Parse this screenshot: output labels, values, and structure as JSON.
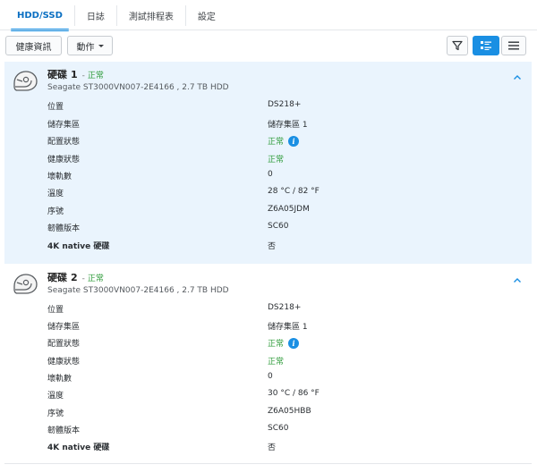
{
  "tabs": [
    {
      "label": "HDD/SSD",
      "active": true
    },
    {
      "label": "日誌",
      "active": false
    },
    {
      "label": "測試排程表",
      "active": false
    },
    {
      "label": "設定",
      "active": false
    }
  ],
  "toolbar": {
    "health_label": "健康資訊",
    "action_label": "動作",
    "filter_icon": "filter-icon",
    "detail_view_icon": "detail-list-icon",
    "list_view_icon": "list-icon",
    "accent_color": "#1a8fe3"
  },
  "disks": [
    {
      "name": "硬碟",
      "number": "1",
      "separator": "-",
      "status": "正常",
      "model": "Seagate ST3000VN007-2E4166 , 2.7 TB HDD",
      "fields": [
        {
          "label": "位置",
          "value": "DS218+"
        },
        {
          "label": "儲存集區",
          "value": "儲存集區 1"
        },
        {
          "label": "配置狀態",
          "value": "正常"
        },
        {
          "label": "健康狀態",
          "value": "正常"
        },
        {
          "label": "壞軌數",
          "value": "0"
        },
        {
          "label": "溫度",
          "value": "28 °C / 82 °F"
        },
        {
          "label": "序號",
          "value": "Z6A05JDM"
        },
        {
          "label": "韌體版本",
          "value": "SC60"
        },
        {
          "label": "4K native 硬碟",
          "value": "否"
        }
      ]
    },
    {
      "name": "硬碟",
      "number": "2",
      "separator": "-",
      "status": "正常",
      "model": "Seagate ST3000VN007-2E4166 , 2.7 TB HDD",
      "fields": [
        {
          "label": "位置",
          "value": "DS218+"
        },
        {
          "label": "儲存集區",
          "value": "儲存集區 1"
        },
        {
          "label": "配置狀態",
          "value": "正常"
        },
        {
          "label": "健康狀態",
          "value": "正常"
        },
        {
          "label": "壞軌數",
          "value": "0"
        },
        {
          "label": "溫度",
          "value": "30 °C / 86 °F"
        },
        {
          "label": "序號",
          "value": "Z6A05HBB"
        },
        {
          "label": "韌體版本",
          "value": "SC60"
        },
        {
          "label": "4K native 硬碟",
          "value": "否"
        }
      ]
    }
  ],
  "colors": {
    "ok_green": "#2e9b3a",
    "selected_bg": "#eaf4fd"
  }
}
